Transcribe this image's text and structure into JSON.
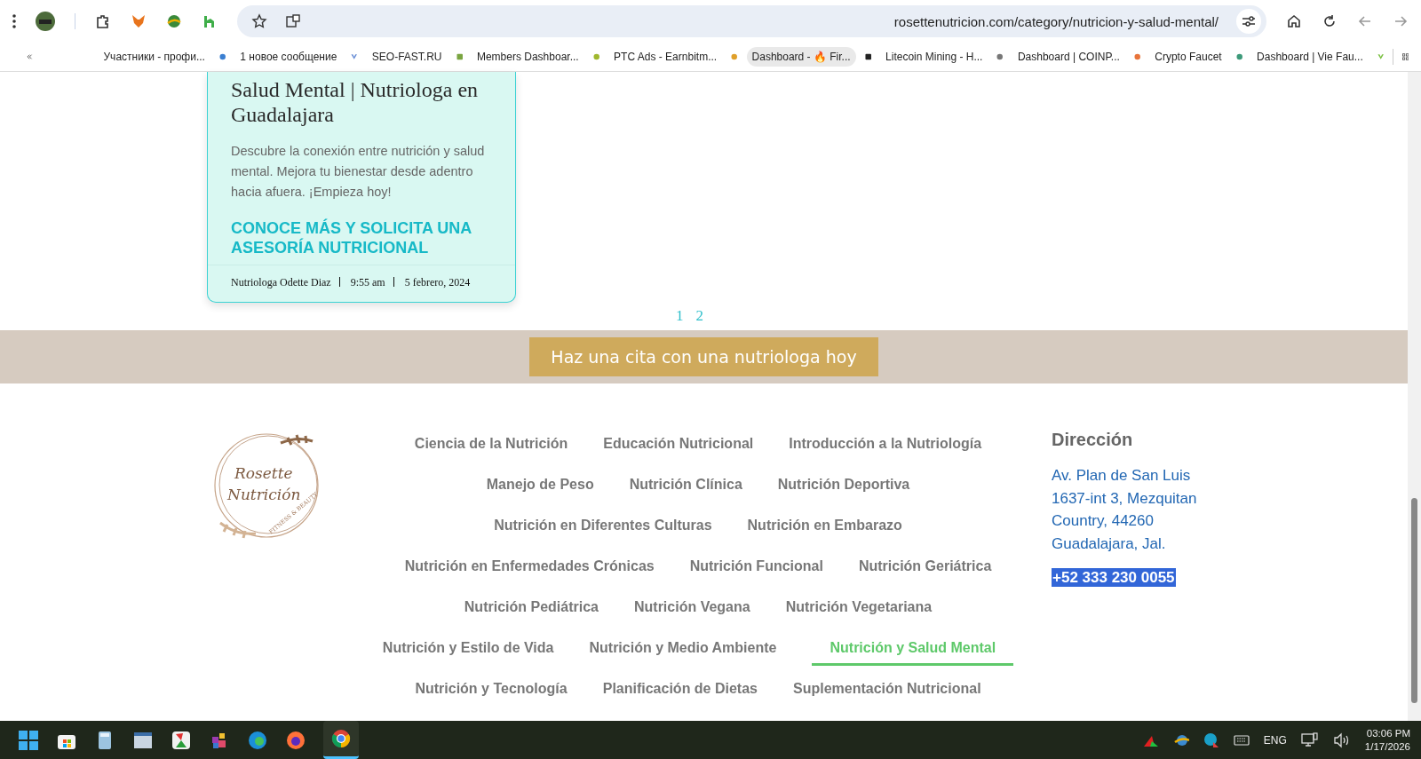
{
  "browser": {
    "url": "rosettenutricion.com/category/nutricion-y-salud-mental/",
    "bookmarks": [
      {
        "label": "Участники - профи...",
        "kind": "sp",
        "selected": false
      },
      {
        "label": "1 новое сообщение",
        "kind": "v",
        "selected": false
      },
      {
        "label": "SEO-FAST.RU",
        "kind": "sf",
        "selected": false
      },
      {
        "label": "Members Dashboar...",
        "kind": "cc",
        "selected": false
      },
      {
        "label": "PTC Ads - Earnbitm...",
        "kind": "coin",
        "selected": false
      },
      {
        "label": "Dashboard - 🔥 Fir...",
        "kind": "f",
        "selected": true
      },
      {
        "label": "Litecoin Mining - H...",
        "kind": "miner",
        "selected": false
      },
      {
        "label": "Dashboard | COINP...",
        "kind": "fox",
        "selected": false
      },
      {
        "label": "Crypto Faucet",
        "kind": "drop",
        "selected": false
      },
      {
        "label": "Dashboard | Vie Fau...",
        "kind": "vf",
        "selected": false
      }
    ]
  },
  "post_card": {
    "title": "Salud Mental | Nutriologa en Guadalajara",
    "excerpt": "Descubre la conexión entre nutrición y salud mental. Mejora tu bienestar desde adentro hacia afuera. ¡Empieza hoy!",
    "link": "CONOCE MÁS Y SOLICITA UNA ASESORÍA NUTRICIONAL",
    "author": "Nutriologa Odette Diaz",
    "time": "9:55 am",
    "date": "5 febrero, 2024"
  },
  "pagination": [
    {
      "label": "1"
    },
    {
      "label": "2"
    }
  ],
  "cta_banner": {
    "button": "Haz una cita con una nutriologa hoy"
  },
  "footer": {
    "logo": {
      "line_1": "Rosette",
      "line_2": "Nutrición",
      "tagline": "FITNESS & BEAUTY"
    },
    "nav_rows": [
      [
        {
          "label": "Ciencia de la Nutrición",
          "selected": false
        },
        {
          "label": "Educación Nutricional",
          "selected": false
        },
        {
          "label": "Introducción a la Nutriología",
          "selected": false
        }
      ],
      [
        {
          "label": "Manejo de Peso",
          "selected": false
        },
        {
          "label": "Nutrición Clínica",
          "selected": false
        },
        {
          "label": "Nutrición Deportiva",
          "selected": false
        }
      ],
      [
        {
          "label": "Nutrición en Diferentes Culturas",
          "selected": false
        },
        {
          "label": "Nutrición en Embarazo",
          "selected": false
        }
      ],
      [
        {
          "label": "Nutrición en Enfermedades Crónicas",
          "selected": false
        },
        {
          "label": "Nutrición Funcional",
          "selected": false
        },
        {
          "label": "Nutrición Geriátrica",
          "selected": false
        }
      ],
      [
        {
          "label": "Nutrición Pediátrica",
          "selected": false
        },
        {
          "label": "Nutrición Vegana",
          "selected": false
        },
        {
          "label": "Nutrición Vegetariana",
          "selected": false
        }
      ],
      [
        {
          "label": "Nutrición y Estilo de Vida",
          "selected": false
        },
        {
          "label": "Nutrición y Medio Ambiente",
          "selected": false
        },
        {
          "label": "Nutrición y Salud Mental",
          "selected": true
        }
      ],
      [
        {
          "label": "Nutrición y Tecnología",
          "selected": false
        },
        {
          "label": "Planificación de Dietas",
          "selected": false
        },
        {
          "label": "Suplementación Nutricional",
          "selected": false
        }
      ]
    ],
    "address": {
      "heading": "Dirección",
      "lines": [
        "Av. Plan de San Luis",
        "1637-int 3, Mezquitan",
        "Country, 44260",
        "Guadalajara, Jal."
      ],
      "phone": "+52 333 230 0055",
      "phone_selected": true
    }
  },
  "taskbar": {
    "language": "ENG",
    "time": "03:06 PM",
    "date": "1/17/2026"
  }
}
